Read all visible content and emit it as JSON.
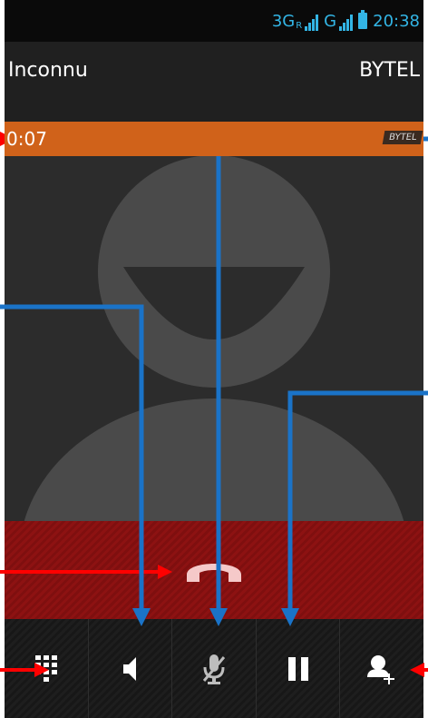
{
  "status_bar": {
    "network_label": "3G",
    "roaming_label": "R",
    "second_network_label": "G",
    "time": "20:38"
  },
  "call": {
    "caller_name": "Inconnu",
    "operator": "BYTEL",
    "duration": "0:07",
    "operator_badge": "BYTEL"
  },
  "controls": [
    {
      "name": "dialpad",
      "icon": "dialpad-icon"
    },
    {
      "name": "speaker",
      "icon": "speaker-icon"
    },
    {
      "name": "mute",
      "icon": "mic-mute-icon"
    },
    {
      "name": "hold",
      "icon": "pause-icon"
    },
    {
      "name": "add-call",
      "icon": "add-contact-icon"
    }
  ],
  "colors": {
    "status_accent": "#33b5e5",
    "timer_bar": "#d0621a",
    "end_call_zone": "#8d1212",
    "end_call_icon": "#f5c9c9",
    "annotation_red": "#ff0000",
    "annotation_blue": "#1a73c8"
  }
}
